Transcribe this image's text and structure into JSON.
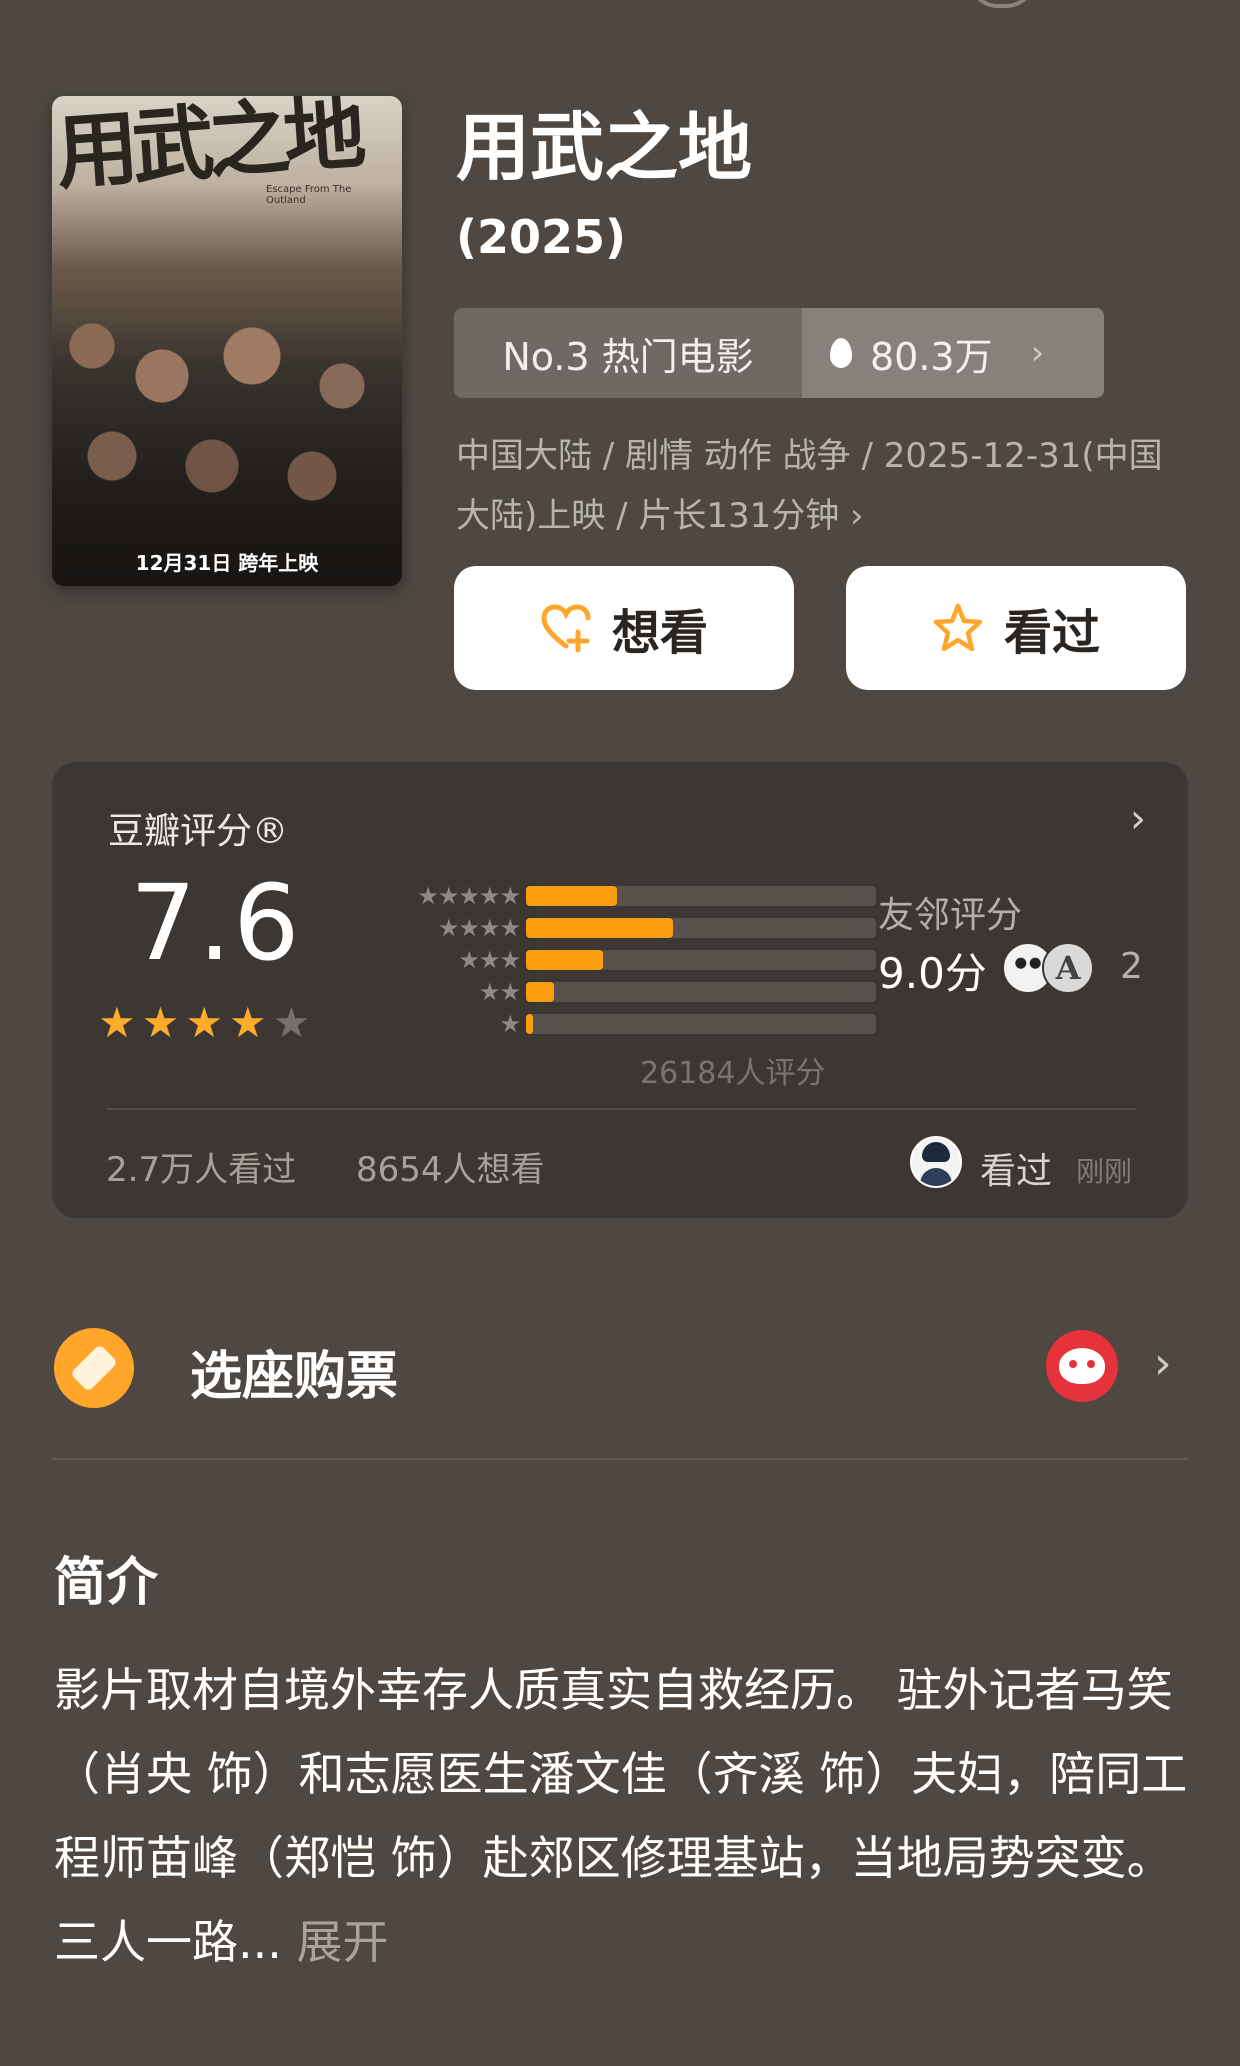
{
  "movie": {
    "title": "用武之地",
    "year": "(2025)",
    "poster": {
      "title_art": "用武之地",
      "english_subtitle": "Escape From The Outland",
      "release_caption": "12月31日 跨年上映"
    },
    "hot_rank": "No.3 热门电影",
    "heat": "80.3万",
    "meta_line": "中国大陆 / 剧情 动作 战争 / 2025-12-31(中国大陆)上映 / 片长131分钟 ›"
  },
  "actions": {
    "want_label": "想看",
    "seen_label": "看过"
  },
  "rating": {
    "label": "豆瓣评分®",
    "score": "7.6",
    "stars_filled": 4,
    "stars_total": 5,
    "distribution": [
      {
        "stars": "★★★★★",
        "fraction": 0.26
      },
      {
        "stars": "★★★★",
        "fraction": 0.42
      },
      {
        "stars": "★★★",
        "fraction": 0.22
      },
      {
        "stars": "★★",
        "fraction": 0.08
      },
      {
        "stars": "★",
        "fraction": 0.02
      }
    ],
    "rating_count": "26184人评分",
    "friends_label": "友邻评分",
    "friends_score": "9.0分",
    "friends_count": "2",
    "seen_count": "2.7万人看过",
    "want_count": "8654人想看",
    "my_status": "看过",
    "my_time": "刚刚"
  },
  "tickets": {
    "label": "选座购票"
  },
  "intro": {
    "heading": "简介",
    "text": "影片取材自境外幸存人质真实自救经历。 驻外记者马笑（肖央 饰）和志愿医生潘文佳（齐溪 饰）夫妇，陪同工程师苗峰（郑恺 饰）赴郊区修理基站，当地局势突变。三人一路... ",
    "more": "展开"
  },
  "colors": {
    "background": "#4f4842",
    "accent": "#ff9d12",
    "card": "#3d3733"
  }
}
